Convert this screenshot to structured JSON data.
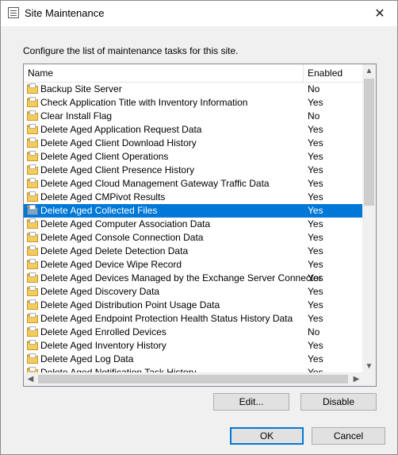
{
  "window": {
    "title": "Site Maintenance",
    "close_glyph": "✕"
  },
  "instruction": "Configure the list of maintenance tasks for this site.",
  "columns": {
    "name": "Name",
    "enabled": "Enabled"
  },
  "tasks": [
    {
      "name": "Backup Site Server",
      "enabled": "No"
    },
    {
      "name": "Check Application Title with Inventory Information",
      "enabled": "Yes"
    },
    {
      "name": "Clear Install Flag",
      "enabled": "No"
    },
    {
      "name": "Delete Aged Application Request Data",
      "enabled": "Yes"
    },
    {
      "name": "Delete Aged Client Download History",
      "enabled": "Yes"
    },
    {
      "name": "Delete Aged Client Operations",
      "enabled": "Yes"
    },
    {
      "name": "Delete Aged Client Presence History",
      "enabled": "Yes"
    },
    {
      "name": "Delete Aged Cloud Management Gateway Traffic Data",
      "enabled": "Yes"
    },
    {
      "name": "Delete Aged CMPivot Results",
      "enabled": "Yes"
    },
    {
      "name": "Delete Aged Collected Files",
      "enabled": "Yes",
      "selected": true
    },
    {
      "name": "Delete Aged Computer Association Data",
      "enabled": "Yes"
    },
    {
      "name": "Delete Aged Console Connection Data",
      "enabled": "Yes"
    },
    {
      "name": "Delete Aged Delete Detection Data",
      "enabled": "Yes"
    },
    {
      "name": "Delete Aged Device Wipe Record",
      "enabled": "Yes"
    },
    {
      "name": "Delete Aged Devices Managed by the Exchange Server Connector",
      "enabled": "Yes"
    },
    {
      "name": "Delete Aged Discovery Data",
      "enabled": "Yes"
    },
    {
      "name": "Delete Aged Distribution Point Usage Data",
      "enabled": "Yes"
    },
    {
      "name": "Delete Aged Endpoint Protection Health Status History Data",
      "enabled": "Yes"
    },
    {
      "name": "Delete Aged Enrolled Devices",
      "enabled": "No"
    },
    {
      "name": "Delete Aged Inventory History",
      "enabled": "Yes"
    },
    {
      "name": "Delete Aged Log Data",
      "enabled": "Yes"
    },
    {
      "name": "Delete Aged Notification Task History",
      "enabled": "Yes"
    }
  ],
  "buttons": {
    "edit": "Edit...",
    "disable": "Disable",
    "ok": "OK",
    "cancel": "Cancel"
  },
  "scroll": {
    "up": "▲",
    "down": "▼",
    "left": "◀",
    "right": "▶"
  },
  "colors": {
    "selection": "#0078d7",
    "dialog_bg": "#f0f0f0"
  }
}
